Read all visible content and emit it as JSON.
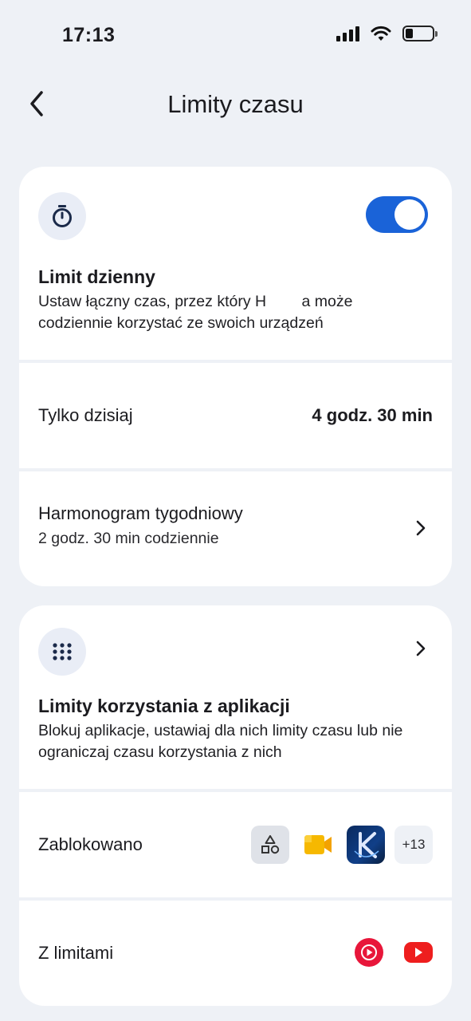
{
  "status_bar": {
    "time": "17:13"
  },
  "header": {
    "title": "Limity czasu"
  },
  "daily_limit": {
    "title": "Limit dzienny",
    "description": "Ustaw łączny czas, przez który H   a może codziennie korzystać ze swoich urządzeń",
    "toggle_on": true,
    "accent_color": "#1a63d8"
  },
  "today_only": {
    "label": "Tylko dzisiaj",
    "value": "4 godz. 30 min"
  },
  "weekly_schedule": {
    "label": "Harmonogram tygodniowy",
    "sub": "2 godz. 30 min codziennie"
  },
  "app_limits": {
    "title": "Limity korzystania z aplikacji",
    "description": "Blokuj aplikacje, ustawiaj dla nich limity czasu lub nie ograniczaj czasu korzystania z nich"
  },
  "blocked": {
    "label": "Zablokowano",
    "more": "+13",
    "icons": [
      "apps-shapes-icon",
      "meet-camera-icon",
      "k-app-icon"
    ]
  },
  "limited": {
    "label": "Z limitami",
    "icons": [
      "youtube-music-icon",
      "youtube-icon"
    ]
  }
}
